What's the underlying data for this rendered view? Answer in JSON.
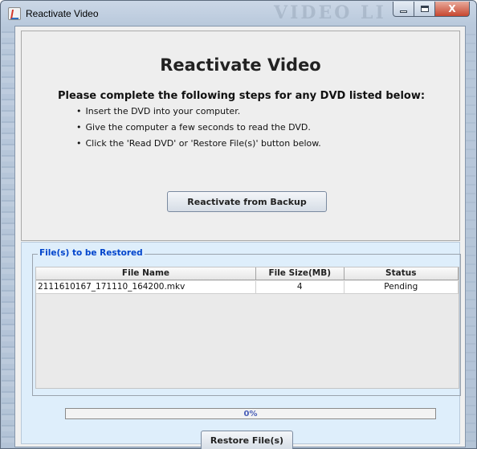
{
  "window": {
    "title": "Reactivate Video",
    "background_ghost_text": "VIDEO LI",
    "minimize_label": "",
    "maximize_label": "",
    "close_label": "X"
  },
  "header": {
    "title": "Reactivate Video",
    "steps_title": "Please complete the following steps for any DVD listed below:",
    "steps": [
      "Insert the DVD into your computer.",
      "Give the computer a few seconds to read the DVD.",
      "Click the 'Read DVD' or 'Restore File(s)' button below."
    ],
    "reactivate_button": "Reactivate from Backup"
  },
  "files": {
    "group_title": "File(s) to be Restored",
    "columns": [
      "File Name",
      "File Size(MB)",
      "Status"
    ],
    "rows": [
      {
        "file_name": "2111610167_171110_164200.mkv",
        "file_size": "4",
        "status": "Pending"
      }
    ]
  },
  "progress": {
    "value": 0,
    "label": "0%"
  },
  "restore_button": "Restore File(s)",
  "colors": {
    "legend": "#0044cc",
    "progress_text": "#4a5fb8",
    "bottom_panel": "#deeefb"
  }
}
